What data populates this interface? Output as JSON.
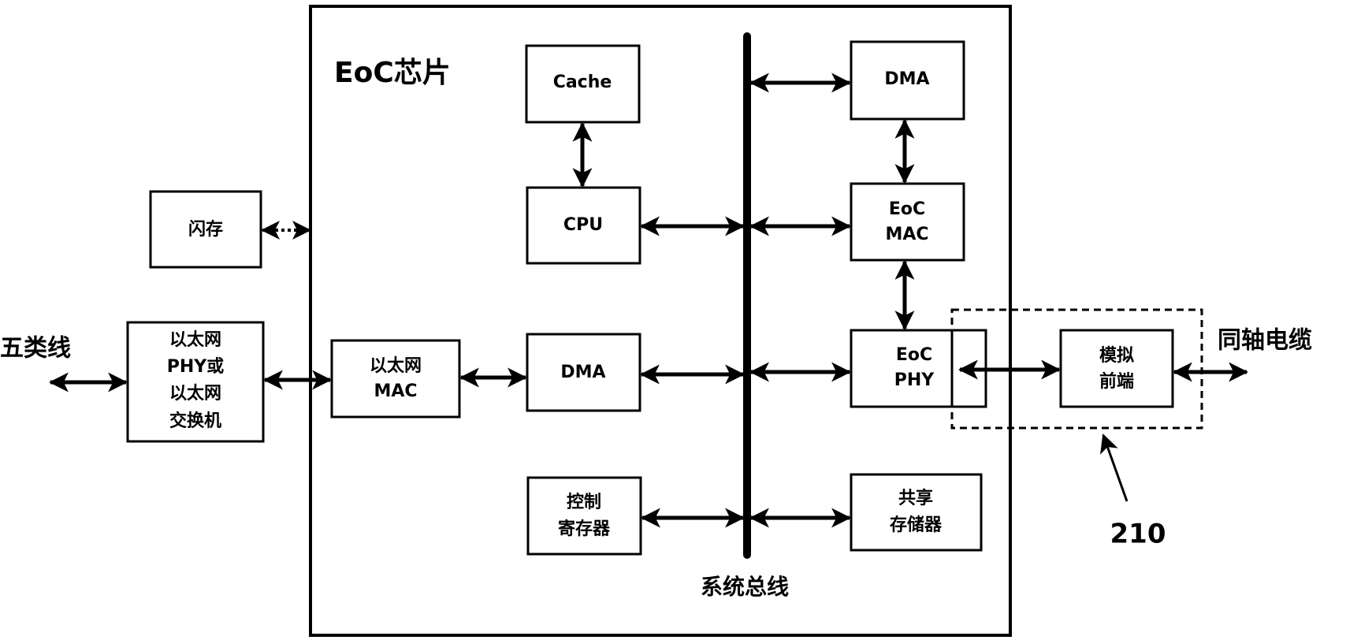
{
  "diagram": {
    "chip_title": "EoC芯片",
    "bus_label": "系统总线",
    "left_cable_label": "五类线",
    "right_cable_label": "同轴电缆",
    "reference_number": "210",
    "blocks": {
      "flash": [
        "闪存"
      ],
      "eth_phy": [
        "以太网",
        "PHY或",
        "以太网",
        "交换机"
      ],
      "eth_mac": [
        "以太网",
        "MAC"
      ],
      "dma_left": [
        "DMA"
      ],
      "cache": [
        "Cache"
      ],
      "cpu": [
        "CPU"
      ],
      "control_reg": [
        "控制",
        "寄存器"
      ],
      "dma_right": [
        "DMA"
      ],
      "eoc_mac": [
        "EoC",
        "MAC"
      ],
      "eoc_phy": [
        "EoC",
        "PHY"
      ],
      "shared_mem": [
        "共享",
        "存储器"
      ],
      "afe": [
        "模拟",
        "前端"
      ]
    },
    "connections": [
      {
        "from": "left_cable",
        "to": "eth_phy",
        "style": "solid",
        "bidirectional": true
      },
      {
        "from": "eth_phy",
        "to": "eth_mac",
        "style": "solid",
        "bidirectional": true
      },
      {
        "from": "flash",
        "to": "chip",
        "style": "dashed",
        "bidirectional": true
      },
      {
        "from": "eth_mac",
        "to": "dma_left",
        "style": "solid",
        "bidirectional": true
      },
      {
        "from": "dma_left",
        "to": "system_bus",
        "style": "solid",
        "bidirectional": true
      },
      {
        "from": "cache",
        "to": "cpu",
        "style": "solid",
        "bidirectional": true
      },
      {
        "from": "cpu",
        "to": "system_bus",
        "style": "solid",
        "bidirectional": true
      },
      {
        "from": "control_reg",
        "to": "system_bus",
        "style": "solid",
        "bidirectional": true
      },
      {
        "from": "system_bus",
        "to": "dma_right",
        "style": "solid",
        "bidirectional": true
      },
      {
        "from": "system_bus",
        "to": "eoc_mac",
        "style": "solid",
        "bidirectional": true
      },
      {
        "from": "system_bus",
        "to": "eoc_phy",
        "style": "solid",
        "bidirectional": true
      },
      {
        "from": "system_bus",
        "to": "shared_mem",
        "style": "solid",
        "bidirectional": true
      },
      {
        "from": "dma_right",
        "to": "eoc_mac",
        "style": "solid",
        "bidirectional": true
      },
      {
        "from": "eoc_mac",
        "to": "eoc_phy",
        "style": "solid",
        "bidirectional": true
      },
      {
        "from": "eoc_phy",
        "to": "afe",
        "style": "solid",
        "bidirectional": true
      },
      {
        "from": "afe",
        "to": "coax_cable",
        "style": "solid",
        "bidirectional": true
      }
    ],
    "colors": {
      "ink": "#000000",
      "background": "#ffffff"
    }
  }
}
